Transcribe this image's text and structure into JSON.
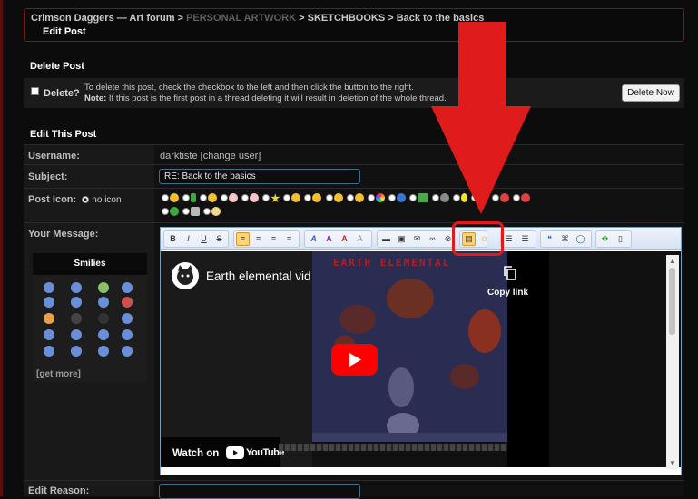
{
  "breadcrumb": {
    "forum": "Crimson Daggers — Art forum",
    "sep": " > ",
    "section": "PERSONAL ARTWORK",
    "subsection": "SKETCHBOOKS",
    "thread": "Back to the basics",
    "page_title": "Edit Post"
  },
  "delete": {
    "heading": "Delete Post",
    "label": "Delete?",
    "line1": "To delete this post, check the checkbox to the left and then click the button to the right.",
    "note_label": "Note:",
    "line2": " If this post is the first post in a thread deleting it will result in deletion of the whole thread.",
    "button": "Delete Now"
  },
  "edit": {
    "heading": "Edit This Post",
    "username_label": "Username:",
    "username_value": "darktiste",
    "change_user": "[change user]",
    "subject_label": "Subject:",
    "subject_value": "RE: Back to the basics",
    "post_icon_label": "Post Icon:",
    "no_icon": "no icon",
    "message_label": "Your Message:",
    "reason_label": "Edit Reason:"
  },
  "smilies": {
    "heading": "Smilies",
    "get_more": "[get more]"
  },
  "video": {
    "title": "Earth elemental vid",
    "copy_link": "Copy link",
    "watch_on": "Watch on",
    "youtube": "YouTube",
    "frame_title": "EARTH ELEMENTAL"
  },
  "colors": {
    "accent_red": "#e01b1b",
    "border_red": "#8a1010"
  }
}
